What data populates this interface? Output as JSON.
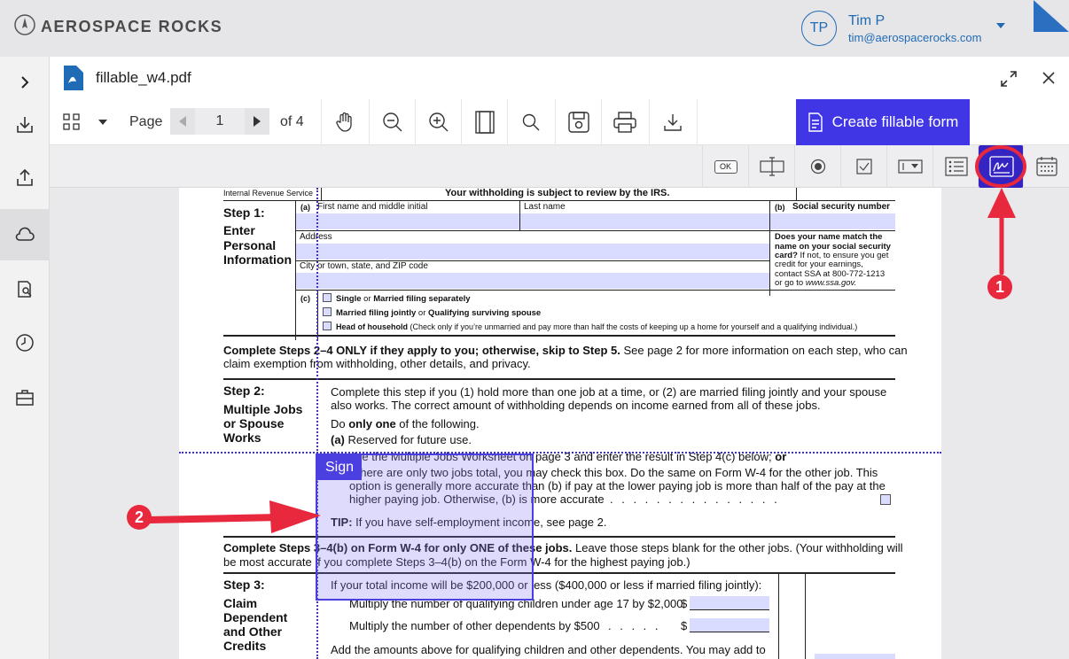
{
  "header": {
    "brand": "AEROSPACE ROCKS",
    "user_initials": "TP",
    "user_name": "Tim P",
    "user_email": "tim@aerospacerocks.com"
  },
  "viewer": {
    "file_name": "fillable_w4.pdf"
  },
  "toolbar": {
    "page_label": "Page",
    "page_number": "1",
    "of_label": "of 4",
    "create_label": "Create fillable form"
  },
  "fieldbar": {
    "ok_label": "OK"
  },
  "document": {
    "irs_label": "Internal Revenue Service",
    "irs_notice": "Your withholding is subject to review by the IRS.",
    "step1_title": "Step 1:",
    "step1_sub1": "Enter",
    "step1_sub2": "Personal",
    "step1_sub3": "Information",
    "a_label": "(a)",
    "first_name": "First name and middle initial",
    "last_name": "Last name",
    "b_label": "(b)",
    "ssn": "Social security number",
    "address": "Address",
    "city": "City or town, state, and ZIP code",
    "name_match_1": "Does your name match the",
    "name_match_2": "name on your social security",
    "name_match_3": "card?",
    "name_match_3b": " If not, to ensure you get",
    "name_match_4": "credit for your earnings,",
    "name_match_5": "contact SSA at 800-772-1213",
    "name_match_6": "or go to ",
    "name_match_6b": "www.ssa.gov.",
    "c_label": "(c)",
    "filing_single_b": "Single",
    "filing_single_or": " or ",
    "filing_single_b2": "Married filing separately",
    "filing_joint_b": "Married filing jointly",
    "filing_joint_or": " or ",
    "filing_joint_b2": "Qualifying surviving spouse",
    "filing_head_b": "Head of household",
    "filing_head_note": " (Check only if you’re unmarried and pay more than half the costs of keeping up a home for yourself and a qualifying individual.)",
    "complete_2_4_b": "Complete Steps 2–4 ONLY if they apply to you; otherwise, skip to Step 5.",
    "complete_2_4_rest": " See page 2 for more information on each step, who can",
    "complete_2_4_line2": "claim exemption from withholding, other details, and privacy.",
    "step2_title": "Step 2:",
    "step2_sub1": "Multiple Jobs",
    "step2_sub2": "or Spouse",
    "step2_sub3": "Works",
    "step2_p1": "Complete this step if you (1) hold more than one job at a time, or (2) are married filing jointly and your spouse",
    "step2_p2": "also works. The correct amount of withholding depends on income earned from all of these jobs.",
    "do_only": "Do ",
    "do_only_b": "only one",
    "do_only_rest": " of the following.",
    "a_item_b": "(a)",
    "a_item": " Reserved for future use.",
    "b_item_frag": "(b) Use the Multiple Jobs Worksheet on page 3 and enter the result in Step 4(c) below;",
    "b_item_or": " or",
    "c_item_1": "(c) If there are only two jobs total, you may check this box. Do the same on Form W-4 for the other job. This",
    "c_item_2": "option is generally more accurate than (b) if pay at the lower paying job is more than half of the pay at the",
    "c_item_3": "higher paying job. Otherwise, (b) is more accurate",
    "c_item_dots": ". . . . . . . . . . . . . . .",
    "tip_b": "TIP:",
    "tip": " If you have self-employment income, see page 2.",
    "complete_3_4_b": "Complete Steps 3–4(b) on Form W-4 for only ONE of these jobs.",
    "complete_3_4_rest": " Leave those steps blank for the other jobs. (Your withholding will",
    "complete_3_4_line2": "be most accurate if you complete Steps 3–4(b) on the Form W-4 for the highest paying job.)",
    "step3_title": "Step 3:",
    "step3_sub1": "Claim",
    "step3_sub2": "Dependent",
    "step3_sub3": "and Other",
    "step3_sub4": "Credits",
    "step3_p1": "If your total income will be $200,000 or less ($400,000 or less if married filing jointly):",
    "step3_children": "Multiply the number of qualifying children under age 17 by $2,000",
    "step3_other": "Multiply the number of other dependents by $500",
    "step3_other_dots": ". . . . .",
    "dollar": "$",
    "step3_add": "Add the amounts above for qualifying children and other dependents. You may add to"
  },
  "overlay": {
    "sign_label": "Sign",
    "marker_1": "1",
    "marker_2": "2"
  },
  "colors": {
    "accent": "#4136e5",
    "annotation": "#e8283c",
    "field_fill": "#d9dcff"
  }
}
